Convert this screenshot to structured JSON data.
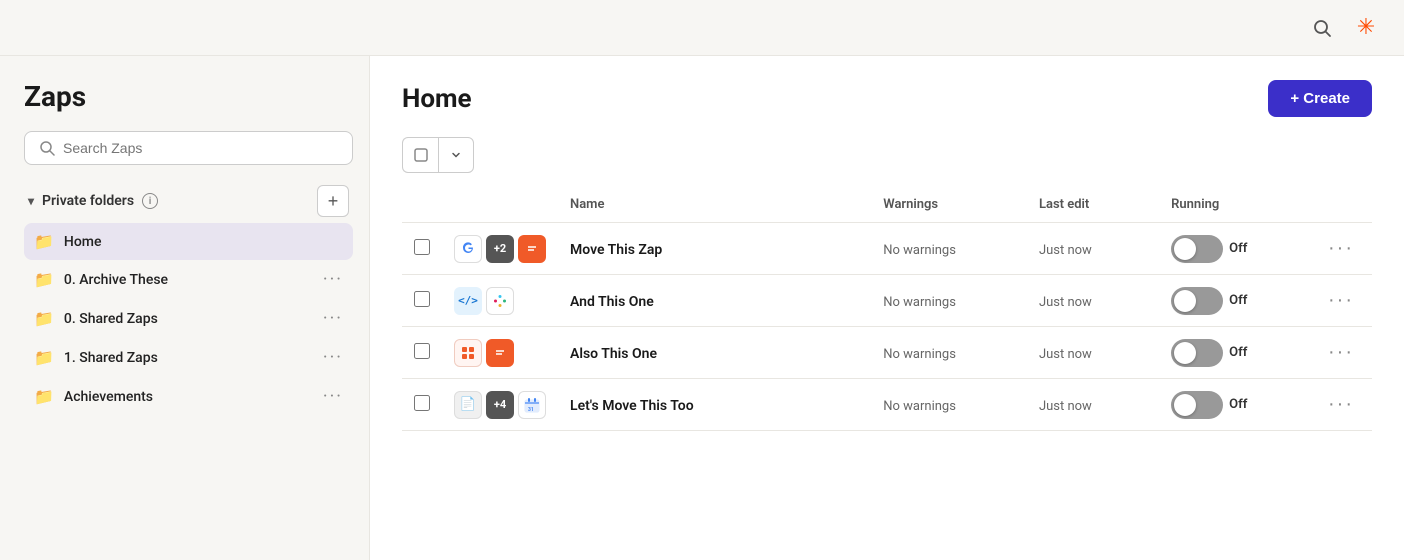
{
  "app": {
    "title": "Zaps"
  },
  "topbar": {
    "search_icon": "search-icon",
    "zapier_icon": "zapier-icon"
  },
  "sidebar": {
    "title": "Zaps",
    "search_placeholder": "Search Zaps",
    "private_folders_label": "Private folders",
    "add_folder_label": "+",
    "folders": [
      {
        "id": "home",
        "label": "Home",
        "active": true
      },
      {
        "id": "archive",
        "label": "0. Archive These",
        "active": false
      },
      {
        "id": "shared0",
        "label": "0. Shared Zaps",
        "active": false
      },
      {
        "id": "shared1",
        "label": "1. Shared Zaps",
        "active": false
      },
      {
        "id": "achievements",
        "label": "Achievements",
        "active": false
      }
    ]
  },
  "main": {
    "title": "Home",
    "create_label": "+ Create",
    "columns": {
      "name": "Name",
      "warnings": "Warnings",
      "last_edit": "Last edit",
      "running": "Running"
    },
    "zaps": [
      {
        "id": 1,
        "name": "Move This Zap",
        "warnings": "No warnings",
        "last_edit": "Just now",
        "running": "Off",
        "icons": [
          "google-workflow",
          "+2",
          "orange-note"
        ]
      },
      {
        "id": 2,
        "name": "And This One",
        "warnings": "No warnings",
        "last_edit": "Just now",
        "running": "Off",
        "icons": [
          "code",
          "slack"
        ]
      },
      {
        "id": 3,
        "name": "Also This One",
        "warnings": "No warnings",
        "last_edit": "Just now",
        "running": "Off",
        "icons": [
          "orange-grid",
          "orange-note2"
        ]
      },
      {
        "id": 4,
        "name": "Let's Move This Too",
        "warnings": "No warnings",
        "last_edit": "Just now",
        "running": "Off",
        "icons": [
          "doc",
          "+4",
          "calendar"
        ]
      }
    ]
  }
}
